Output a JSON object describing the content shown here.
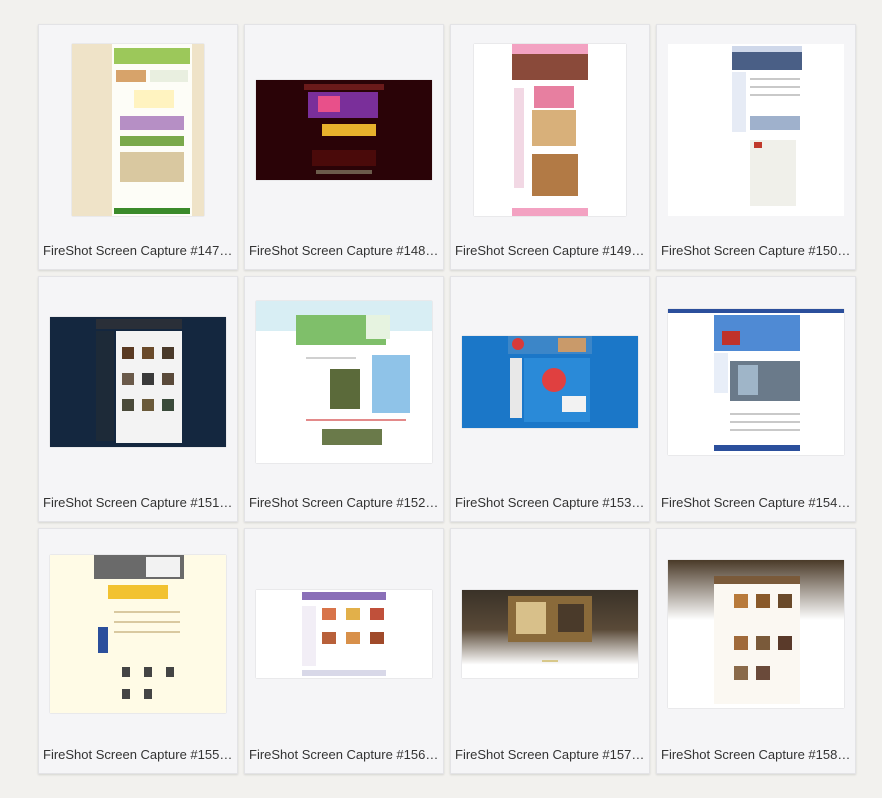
{
  "thumbnails": [
    {
      "caption": "FireShot Screen Capture #147 - ...",
      "color": "#efe3c8"
    },
    {
      "caption": "FireShot Screen Capture #148 - ...",
      "color": "#2a0307"
    },
    {
      "caption": "FireShot Screen Capture #149 - ...",
      "color": "#ffffff"
    },
    {
      "caption": "FireShot Screen Capture #150 - ...",
      "color": "#ffffff"
    },
    {
      "caption": "FireShot Screen Capture #151 - ...",
      "color": "#14273f"
    },
    {
      "caption": "FireShot Screen Capture #152 - ...",
      "color": "#ffffff"
    },
    {
      "caption": "FireShot Screen Capture #153 - ...",
      "color": "#1b77c8"
    },
    {
      "caption": "FireShot Screen Capture #154 - ...",
      "color": "#ffffff"
    },
    {
      "caption": "FireShot Screen Capture #155 - ...",
      "color": "#fffbe6"
    },
    {
      "caption": "FireShot Screen Capture #156 - ...",
      "color": "#ffffff"
    },
    {
      "caption": "FireShot Screen Capture #157 - ...",
      "color": "#3a3228"
    },
    {
      "caption": "FireShot Screen Capture #158 - ...",
      "color": "#ffffff"
    }
  ]
}
